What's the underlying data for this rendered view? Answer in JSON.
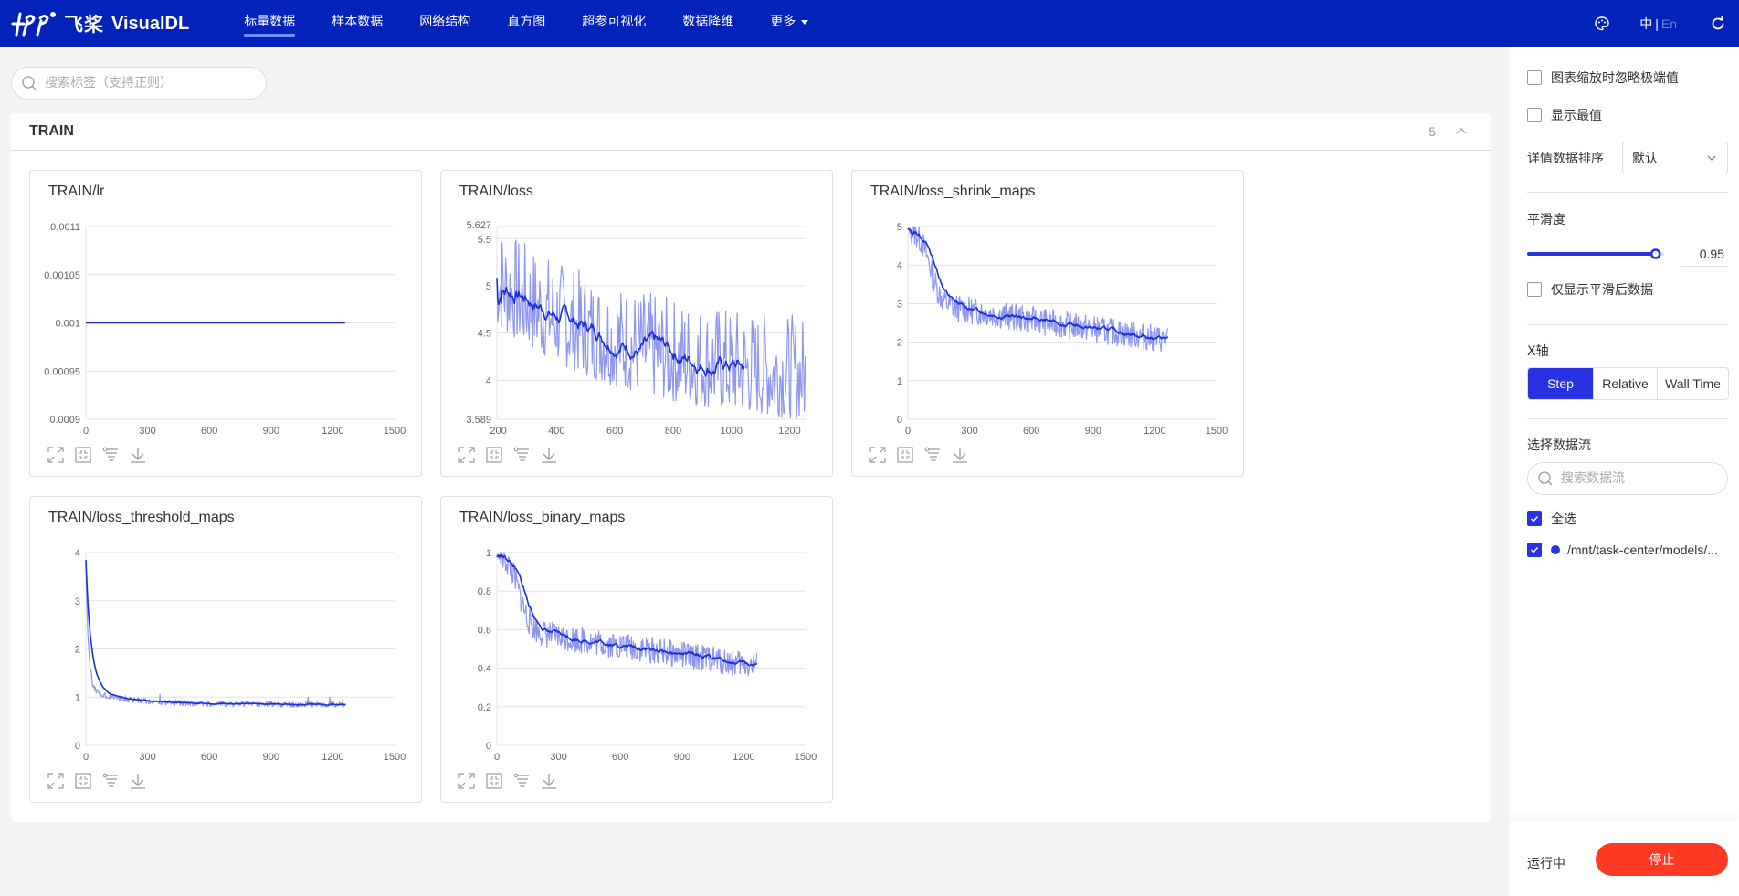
{
  "header": {
    "brand_cn": "飞桨",
    "brand": "VisualDL",
    "nav": [
      {
        "label": "标量数据",
        "active": true
      },
      {
        "label": "样本数据",
        "active": false
      },
      {
        "label": "网络结构",
        "active": false
      },
      {
        "label": "直方图",
        "active": false
      },
      {
        "label": "超参可视化",
        "active": false
      },
      {
        "label": "数据降维",
        "active": false
      },
      {
        "label": "更多",
        "active": false,
        "dropdown": true
      }
    ],
    "lang_current": "中",
    "lang_separator": "|",
    "lang_other": "En",
    "icons": [
      "theme-palette-icon",
      "refresh-icon"
    ]
  },
  "search": {
    "placeholder": "搜索标签（支持正则）",
    "value": ""
  },
  "section": {
    "title": "TRAIN",
    "count": "5",
    "collapse_icon": "chevron-up-icon"
  },
  "toolbar_icons": [
    "maximize-icon",
    "restore-zoom-icon",
    "filter-icon",
    "download-icon"
  ],
  "colors": {
    "accent": "#2932e1",
    "raw_line": "#8e96f0",
    "smooth_line": "#1a2fd6",
    "header_bg": "#0322b9",
    "stop": "#ff3a24"
  },
  "chart_data": [
    {
      "type": "line",
      "title": "TRAIN/lr",
      "x": {
        "ticks": [
          0,
          300,
          600,
          900,
          1200,
          1500
        ],
        "range": [
          0,
          1500
        ]
      },
      "y": {
        "ticks": [
          "0.0009",
          "0.00095",
          "0.001",
          "0.00105",
          "0.0011"
        ],
        "range": [
          0.0009,
          0.0011
        ]
      },
      "grid": true,
      "series": [
        {
          "name": "/mnt/task-center/models/...",
          "kind": "constant",
          "x_start": 0,
          "x_end": 1260,
          "value": 0.001,
          "noise": 0,
          "seed": 1
        }
      ]
    },
    {
      "type": "line",
      "title": "TRAIN/loss",
      "x": {
        "ticks": [
          200,
          400,
          600,
          800,
          1000,
          1200
        ],
        "range": [
          195,
          1255
        ]
      },
      "y": {
        "ticks": [
          "3.589",
          "4",
          "4.5",
          "5",
          "5.5",
          "5.627"
        ],
        "range": [
          3.589,
          5.627
        ]
      },
      "grid": true,
      "series": [
        {
          "name": "/mnt/task-center/models/...",
          "kind": "decay",
          "x_start": 195,
          "x_end": 1255,
          "start": 4.95,
          "end": 3.85,
          "rate": 2.2,
          "noise": 0.55,
          "seed": 7,
          "smooth_end_x": 1045
        }
      ]
    },
    {
      "type": "line",
      "title": "TRAIN/loss_shrink_maps",
      "x": {
        "ticks": [
          0,
          300,
          600,
          900,
          1200,
          1500
        ],
        "range": [
          0,
          1500
        ]
      },
      "y": {
        "ticks": [
          "0",
          "1",
          "2",
          "3",
          "4",
          "5"
        ],
        "range": [
          0,
          5
        ]
      },
      "grid": true,
      "series": [
        {
          "name": "/mnt/task-center/models/...",
          "kind": "sigmoid",
          "x_start": 0,
          "x_end": 1265,
          "start": 4.95,
          "plateau": 2.9,
          "end": 2.05,
          "knee": 110,
          "noise": 0.35,
          "seed": 13
        }
      ]
    },
    {
      "type": "line",
      "title": "TRAIN/loss_threshold_maps",
      "x": {
        "ticks": [
          0,
          300,
          600,
          900,
          1200,
          1500
        ],
        "range": [
          0,
          1500
        ]
      },
      "y": {
        "ticks": [
          "0",
          "1",
          "2",
          "3",
          "4"
        ],
        "range": [
          0,
          4
        ]
      },
      "grid": true,
      "series": [
        {
          "name": "/mnt/task-center/models/...",
          "kind": "spike",
          "x_start": 0,
          "x_end": 1265,
          "start": 3.85,
          "plateau": 1.15,
          "end": 0.85,
          "knee": 12,
          "noise": 0.06,
          "seed": 21
        }
      ]
    },
    {
      "type": "line",
      "title": "TRAIN/loss_binary_maps",
      "x": {
        "ticks": [
          0,
          300,
          600,
          900,
          1200,
          1500
        ],
        "range": [
          0,
          1500
        ]
      },
      "y": {
        "ticks": [
          "0",
          "0.2",
          "0.4",
          "0.6",
          "0.8",
          "1"
        ],
        "range": [
          0,
          1
        ]
      },
      "grid": true,
      "series": [
        {
          "name": "/mnt/task-center/models/...",
          "kind": "sigmoid",
          "x_start": 0,
          "x_end": 1265,
          "start": 0.99,
          "plateau": 0.58,
          "end": 0.41,
          "knee": 110,
          "noise": 0.07,
          "seed": 33
        }
      ]
    }
  ],
  "panel": {
    "ignore_outliers_label": "图表缩放时忽略极端值",
    "ignore_outliers_checked": false,
    "show_extremes_label": "显示最值",
    "show_extremes_checked": false,
    "sort_label": "详情数据排序",
    "sort_value": "默认",
    "smoothing_label": "平滑度",
    "smoothing_value": "0.95",
    "smoothing_fraction": 0.95,
    "only_smoothed_label": "仅显示平滑后数据",
    "only_smoothed_checked": false,
    "xaxis_label": "X轴",
    "xaxis_options": [
      "Step",
      "Relative",
      "Wall Time"
    ],
    "xaxis_selected": "Step",
    "streams_label": "选择数据流",
    "streams_search_placeholder": "搜索数据流",
    "select_all_label": "全选",
    "select_all_checked": true,
    "streams": [
      {
        "name": "/mnt/task-center/models/...",
        "checked": true,
        "color": "#2932e1"
      }
    ],
    "run_status": "运行中",
    "stop_label": "停止"
  }
}
